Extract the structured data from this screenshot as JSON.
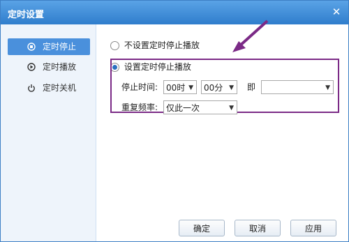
{
  "window": {
    "title": "定时设置",
    "close_glyph": "✕"
  },
  "sidebar": {
    "items": [
      {
        "label": "定时停止",
        "icon": "stop-circle-icon",
        "active": true
      },
      {
        "label": "定时播放",
        "icon": "play-circle-icon",
        "active": false
      },
      {
        "label": "定时关机",
        "icon": "power-icon",
        "active": false
      }
    ]
  },
  "options": {
    "no_stop_label": "不设置定时停止播放",
    "set_stop_label": "设置定时停止播放",
    "selected": "set_stop"
  },
  "form": {
    "stop_time_label": "停止时间:",
    "hour_value": "00时",
    "minute_value": "00分",
    "immediate_label": "即",
    "immediate_value": "",
    "repeat_label": "重复频率:",
    "repeat_value": "仅此一次"
  },
  "buttons": {
    "ok": "确定",
    "cancel": "取消",
    "apply": "应用"
  },
  "colors": {
    "accent": "#4a90dc",
    "highlight_box": "#7b2a86"
  }
}
